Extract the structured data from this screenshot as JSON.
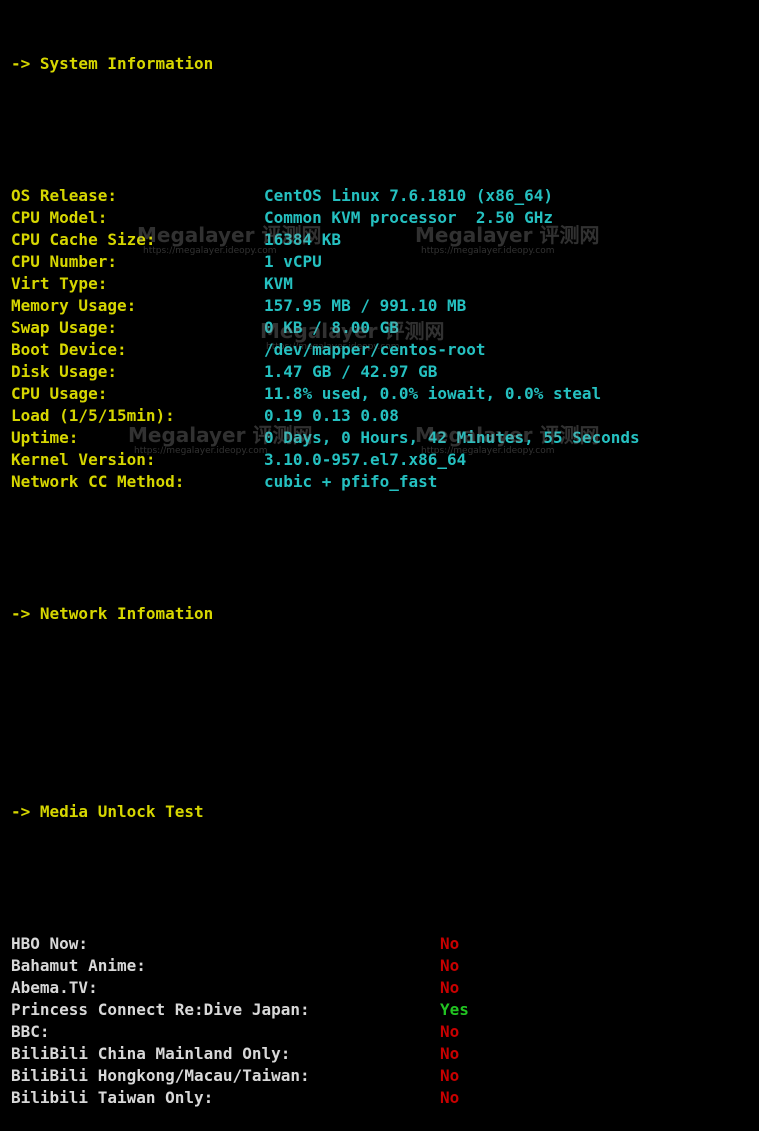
{
  "sections": {
    "system": {
      "header": "-> System Information"
    },
    "network": {
      "header": "-> Network Infomation"
    },
    "media": {
      "header": "-> Media Unlock Test"
    }
  },
  "system_info": [
    {
      "label": "OS Release:",
      "value": "CentOS Linux 7.6.1810 (x86_64)"
    },
    {
      "label": "CPU Model:",
      "value": "Common KVM processor  2.50 GHz"
    },
    {
      "label": "CPU Cache Size:",
      "value": "16384 KB"
    },
    {
      "label": "CPU Number:",
      "value": "1 vCPU"
    },
    {
      "label": "Virt Type:",
      "value": "KVM"
    },
    {
      "label": "Memory Usage:",
      "value": "157.95 MB / 991.10 MB"
    },
    {
      "label": "Swap Usage:",
      "value": "0 KB / 8.00 GB"
    },
    {
      "label": "Boot Device:",
      "value": "/dev/mapper/centos-root"
    },
    {
      "label": "Disk Usage:",
      "value": "1.47 GB / 42.97 GB"
    },
    {
      "label": "CPU Usage:",
      "value": "11.8% used, 0.0% iowait, 0.0% steal"
    },
    {
      "label": "Load (1/5/15min):",
      "value": "0.19 0.13 0.08"
    },
    {
      "label": "Uptime:",
      "value": "0 Days, 0 Hours, 42 Minutes, 55 Seconds"
    },
    {
      "label": "Kernel Version:",
      "value": "3.10.0-957.el7.x86_64"
    },
    {
      "label": "Network CC Method:",
      "value": "cubic + pfifo_fast"
    }
  ],
  "media_unlock": [
    {
      "label": "HBO Now:",
      "value": "No"
    },
    {
      "label": "Bahamut Anime:",
      "value": "No"
    },
    {
      "label": "Abema.TV:",
      "value": "No"
    },
    {
      "label": "Princess Connect Re:Dive Japan:",
      "value": "Yes"
    },
    {
      "label": "BBC:",
      "value": "No"
    },
    {
      "label": "BiliBili China Mainland Only:",
      "value": "No"
    },
    {
      "label": "BiliBili Hongkong/Macau/Taiwan:",
      "value": "No"
    },
    {
      "label": "Bilibili Taiwan Only:",
      "value": "No"
    }
  ],
  "watermark": {
    "title": "Megalayer 评测网",
    "url": "https://megalayer.ideopy.com"
  },
  "colors": {
    "header": "#d6d600",
    "value": "#25c0c0",
    "media_label": "#d8d8d8",
    "no": "#c80000",
    "yes": "#22c422",
    "background": "#000000"
  }
}
